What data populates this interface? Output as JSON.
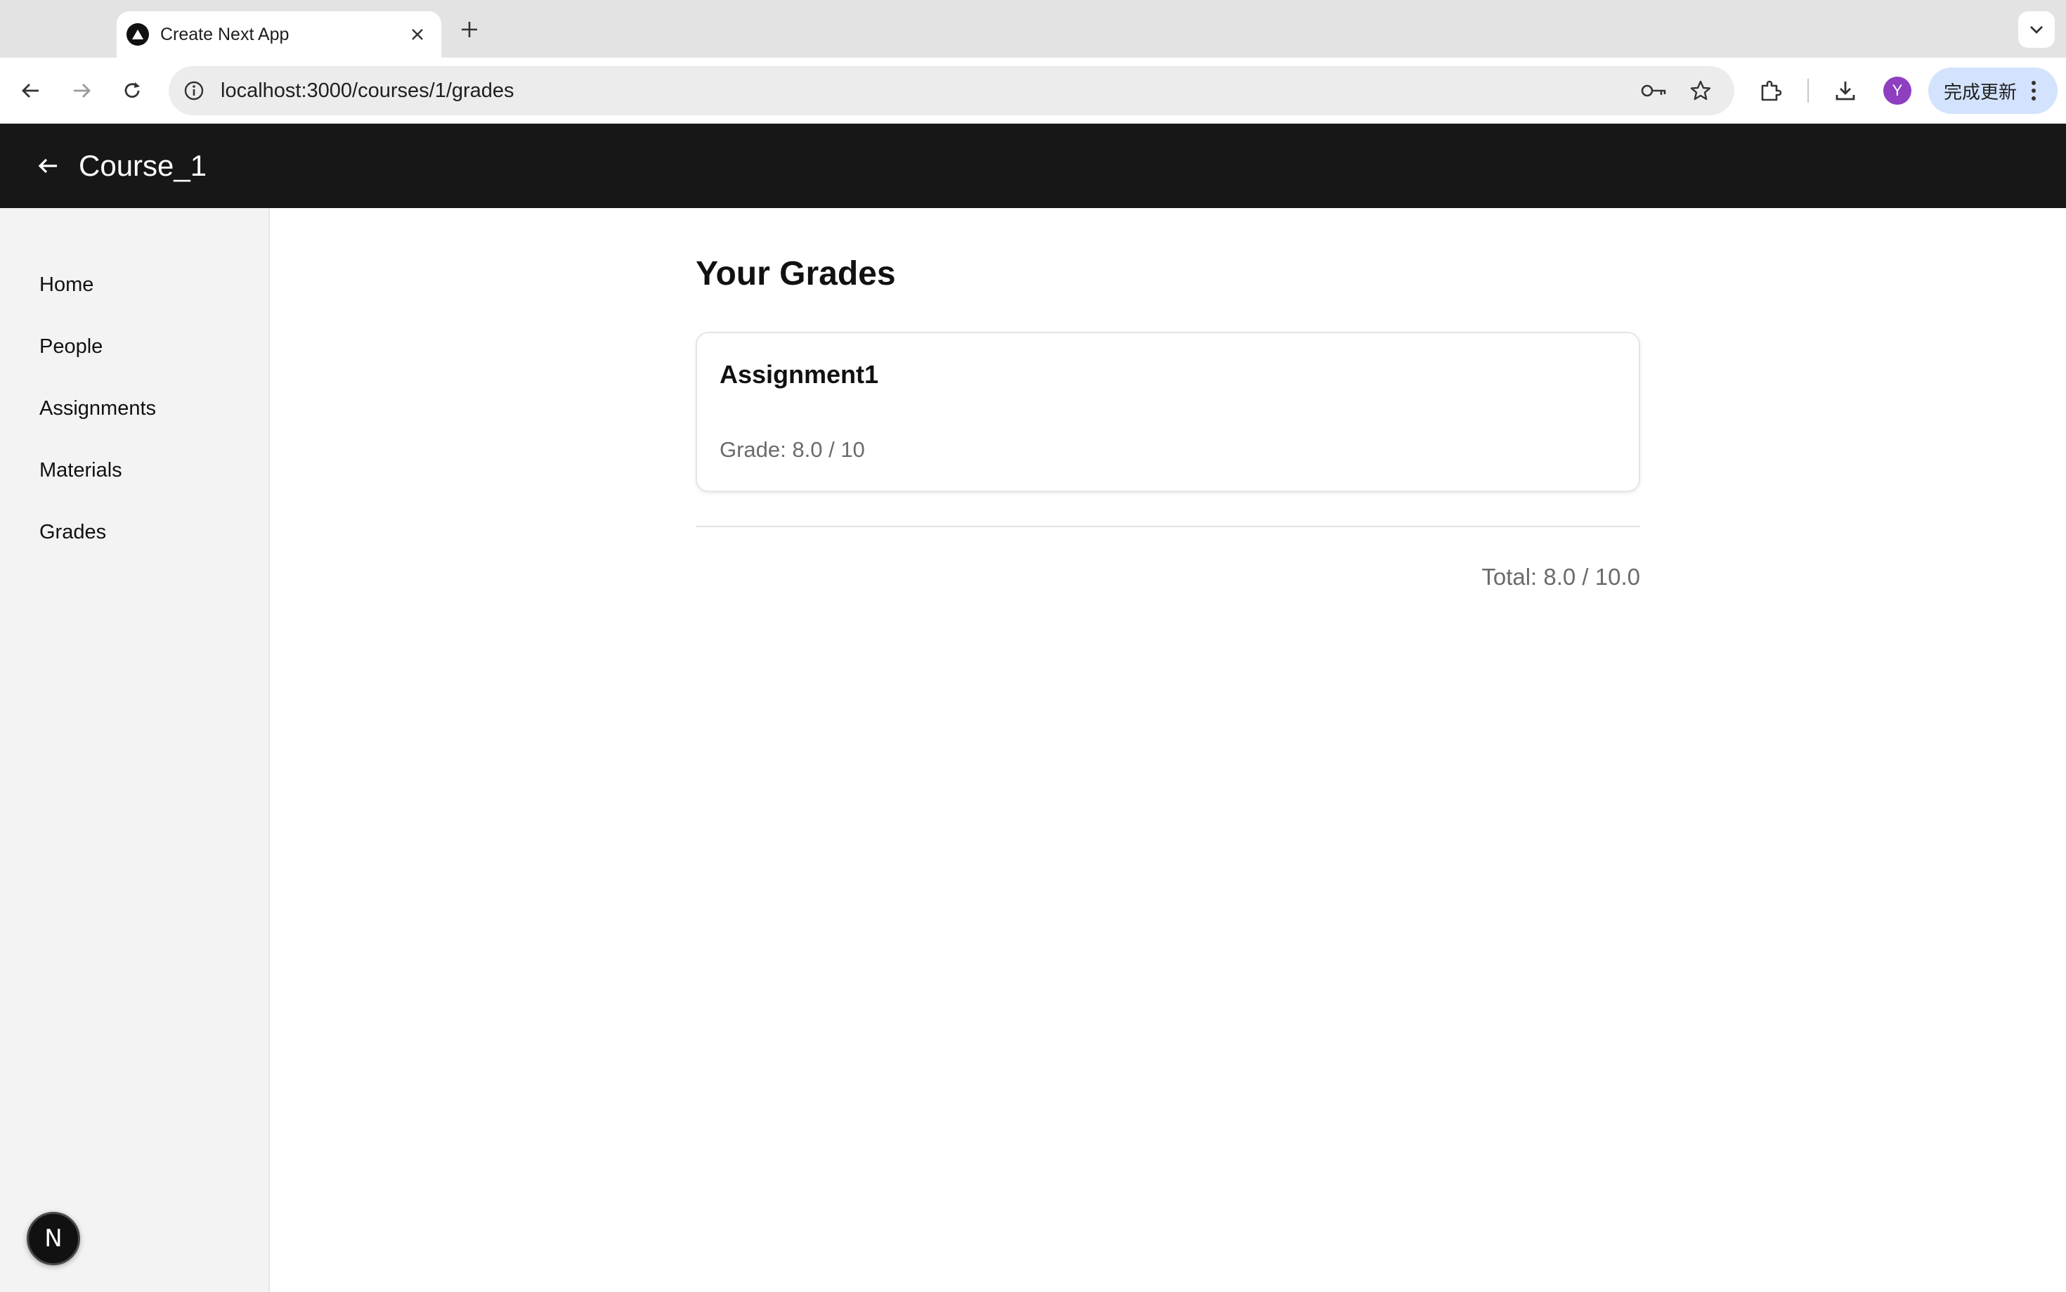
{
  "browser": {
    "tab": {
      "title": "Create Next App"
    },
    "new_tab_symbol": "+",
    "address": {
      "host": "localhost",
      "path": ":3000/courses/1/grades"
    },
    "profile_initial": "Y",
    "update_label": "完成更新"
  },
  "header": {
    "course_title": "Course_1"
  },
  "sidebar": {
    "items": [
      {
        "label": "Home"
      },
      {
        "label": "People"
      },
      {
        "label": "Assignments"
      },
      {
        "label": "Materials"
      },
      {
        "label": "Grades"
      }
    ]
  },
  "main": {
    "title": "Your Grades",
    "grades": [
      {
        "name": "Assignment1",
        "grade_text": "Grade: 8.0 / 10"
      }
    ],
    "total_text": "Total: 8.0 / 10.0"
  },
  "dev_badge": {
    "letter": "N"
  },
  "colors": {
    "header_bg": "#171717",
    "sidebar_bg": "#f3f3f3",
    "avatar_bg": "#8e3fbf",
    "update_btn_bg": "#d3e3fd"
  }
}
